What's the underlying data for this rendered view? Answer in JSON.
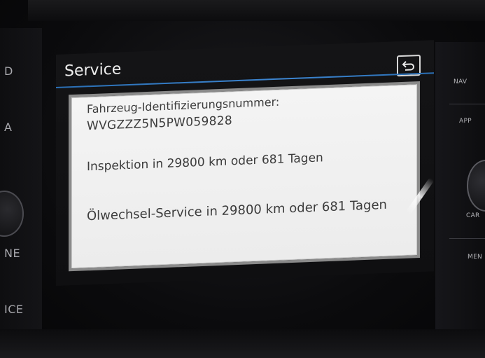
{
  "screen": {
    "title": "Service",
    "back_icon": "back-arrow-icon"
  },
  "service_info": {
    "vin_label": "Fahrzeug-Identifizierungsnummer:",
    "vin_value": "WVGZZZ5N5PW059828",
    "inspection": "Inspektion in 29800 km oder 681 Tagen",
    "oil_service": "Ölwechsel-Service in 29800 km oder 681 Tagen"
  },
  "left_buttons": [
    "D",
    "A",
    "NE",
    "ICE"
  ],
  "right_buttons": [
    "NAV",
    "APP",
    "CAR",
    "MEN"
  ],
  "colors": {
    "accent_blue": "#3d86d2",
    "panel_bg": "#f0f0f0",
    "panel_border": "#8a8a8a",
    "text_dark": "#3c3c3c",
    "title_text": "#eeeeee"
  }
}
